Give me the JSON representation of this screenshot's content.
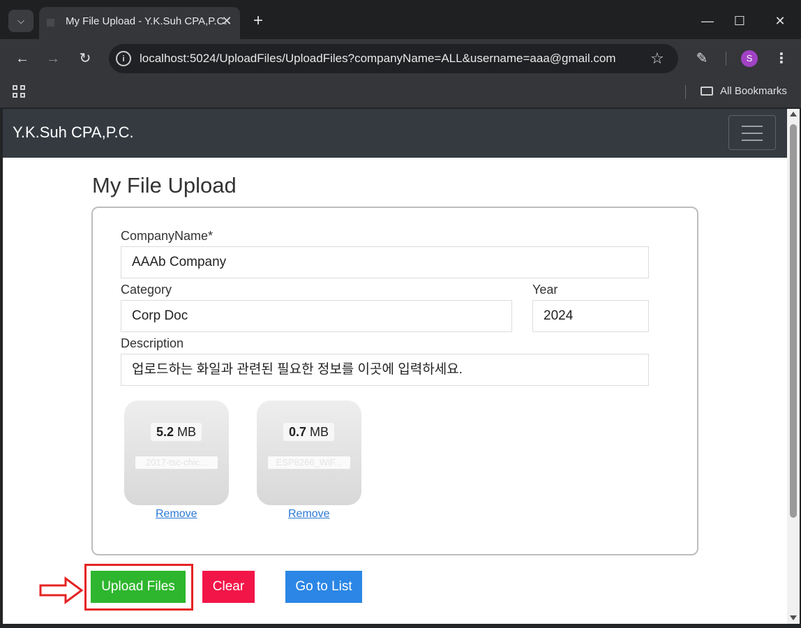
{
  "browser": {
    "tab_title": "My File Upload - Y.K.Suh CPA,P.C.",
    "url": "localhost:5024/UploadFiles/UploadFiles?companyName=ALL&username=aaa@gmail.com",
    "profile_initial": "S",
    "bookmarks_label": "All Bookmarks",
    "icons": [
      "chevron-down-icon",
      "close-icon",
      "plus-icon",
      "minimize-icon",
      "maximize-icon",
      "back-icon",
      "forward-icon",
      "reload-icon",
      "site-info-icon",
      "star-icon",
      "extensions-icon",
      "kebab-menu-icon",
      "apps-icon",
      "folder-icon"
    ]
  },
  "navbar": {
    "brand": "Y.K.Suh CPA,P.C."
  },
  "page": {
    "title": "My File Upload"
  },
  "form": {
    "company_label": "CompanyName*",
    "company_value": "AAAb Company",
    "category_label": "Category",
    "category_value": "Corp Doc",
    "year_label": "Year",
    "year_value": "2024",
    "description_label": "Description",
    "description_value": "업로드하는 화일과 관련된 필요한 정보를 이곳에 입력하세요."
  },
  "files": [
    {
      "size_value": "5.2",
      "size_unit": "MB",
      "name": "2017-tsc-chic...",
      "remove_label": "Remove"
    },
    {
      "size_value": "0.7",
      "size_unit": "MB",
      "name": "ESP8266_WiF...",
      "remove_label": "Remove"
    }
  ],
  "actions": {
    "upload_label": "Upload Files",
    "clear_label": "Clear",
    "list_label": "Go to List"
  },
  "colors": {
    "upload": "#2eb62e",
    "clear": "#f21548",
    "list": "#2b86e5",
    "highlight": "#e52323",
    "navbar": "#343a40"
  }
}
